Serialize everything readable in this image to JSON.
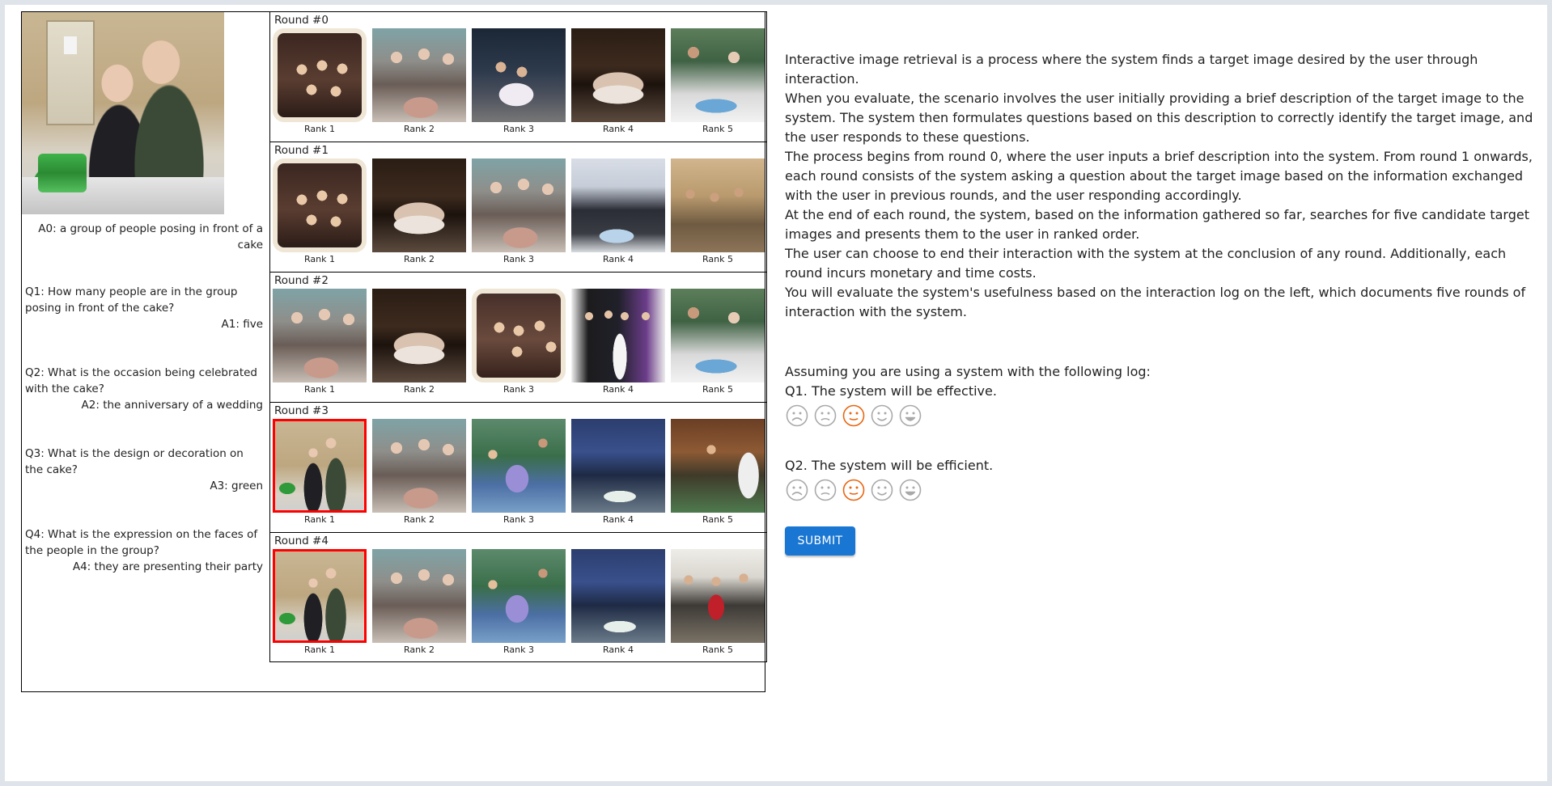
{
  "log": {
    "a0": "A0: a group of people posing in front of a cake",
    "qa": [
      {
        "q": "Q1: How many people are in the group posing in front of the cake?",
        "a": "A1: five"
      },
      {
        "q": "Q2: What is the occasion being celebrated with the cake?",
        "a": "A2: the anniversary of a wedding"
      },
      {
        "q": "Q3: What is the design or decoration on the cake?",
        "a": "A3: green"
      },
      {
        "q": "Q4: What is the expression on the faces of the people in the group?",
        "a": "A4: they are presenting their party"
      }
    ],
    "rounds": [
      {
        "title": "Round #0",
        "candidates": [
          {
            "rank": "Rank 1",
            "style": "ph-friends",
            "target": false
          },
          {
            "rank": "Rank 2",
            "style": "ph-elders",
            "target": false
          },
          {
            "rank": "Rank 3",
            "style": "ph-dark-party",
            "target": false
          },
          {
            "rank": "Rank 4",
            "style": "ph-dark-cake",
            "target": false
          },
          {
            "rank": "Rank 5",
            "style": "ph-cutting",
            "target": false
          }
        ]
      },
      {
        "title": "Round #1",
        "candidates": [
          {
            "rank": "Rank 1",
            "style": "ph-friends",
            "target": false
          },
          {
            "rank": "Rank 2",
            "style": "ph-dark-cake",
            "target": false
          },
          {
            "rank": "Rank 3",
            "style": "ph-elders",
            "target": false
          },
          {
            "rank": "Rank 4",
            "style": "ph-hall",
            "target": false
          },
          {
            "rank": "Rank 5",
            "style": "ph-crowd-tan",
            "target": false
          }
        ]
      },
      {
        "title": "Round #2",
        "candidates": [
          {
            "rank": "Rank 1",
            "style": "ph-elders",
            "target": false
          },
          {
            "rank": "Rank 2",
            "style": "ph-dark-cake",
            "target": false
          },
          {
            "rank": "Rank 3",
            "style": "ph-friends-b",
            "target": false
          },
          {
            "rank": "Rank 4",
            "style": "ph-wedding",
            "target": false
          },
          {
            "rank": "Rank 5",
            "style": "ph-cutting",
            "target": false
          }
        ]
      },
      {
        "title": "Round #3",
        "candidates": [
          {
            "rank": "Rank 1",
            "style": "ph-target",
            "target": true
          },
          {
            "rank": "Rank 2",
            "style": "ph-elders",
            "target": false
          },
          {
            "rank": "Rank 3",
            "style": "ph-kids",
            "target": false
          },
          {
            "rank": "Rank 4",
            "style": "ph-blue-room",
            "target": false
          },
          {
            "rank": "Rank 5",
            "style": "ph-warm-crowd",
            "target": false
          }
        ]
      },
      {
        "title": "Round #4",
        "candidates": [
          {
            "rank": "Rank 1",
            "style": "ph-target",
            "target": true
          },
          {
            "rank": "Rank 2",
            "style": "ph-elders",
            "target": false
          },
          {
            "rank": "Rank 3",
            "style": "ph-kids",
            "target": false
          },
          {
            "rank": "Rank 4",
            "style": "ph-blue-room",
            "target": false
          },
          {
            "rank": "Rank 5",
            "style": "ph-white-crowd",
            "target": false
          }
        ]
      }
    ]
  },
  "instructions": [
    "Interactive image retrieval is a process where the system finds a target image desired by the user through interaction.",
    "When you evaluate, the scenario involves the user initially providing a brief description of the target image to the system. The system then formulates questions based on this description to correctly identify the target image, and the user responds to these questions.",
    "The process begins from round 0, where the user inputs a brief description into the system. From round 1 onwards, each round consists of the system asking a question about the target image based on the information exchanged with the user in previous rounds, and the user responding accordingly.",
    "At the end of each round, the system, based on the information gathered so far, searches for five candidate target images and presents them to the user in ranked order.",
    "The user can choose to end their interaction with the system at the conclusion of any round. Additionally, each round incurs monetary and time costs.",
    "You will evaluate the system's usefulness based on the interaction log on the left, which documents five rounds of interaction with the system."
  ],
  "survey": {
    "intro": "Assuming you are using a system with the following log:",
    "q1": "Q1. The system will be effective.",
    "q2": "Q2. The system will be efficient.",
    "q1_selected": 3,
    "q2_selected": 3,
    "faces": [
      "very-dissatisfied-icon",
      "dissatisfied-icon",
      "neutral-icon",
      "satisfied-icon",
      "very-satisfied-icon"
    ],
    "selected_color": "#e8650f",
    "unselected_color": "#a9a9a9"
  },
  "submit_label": "SUBMIT"
}
